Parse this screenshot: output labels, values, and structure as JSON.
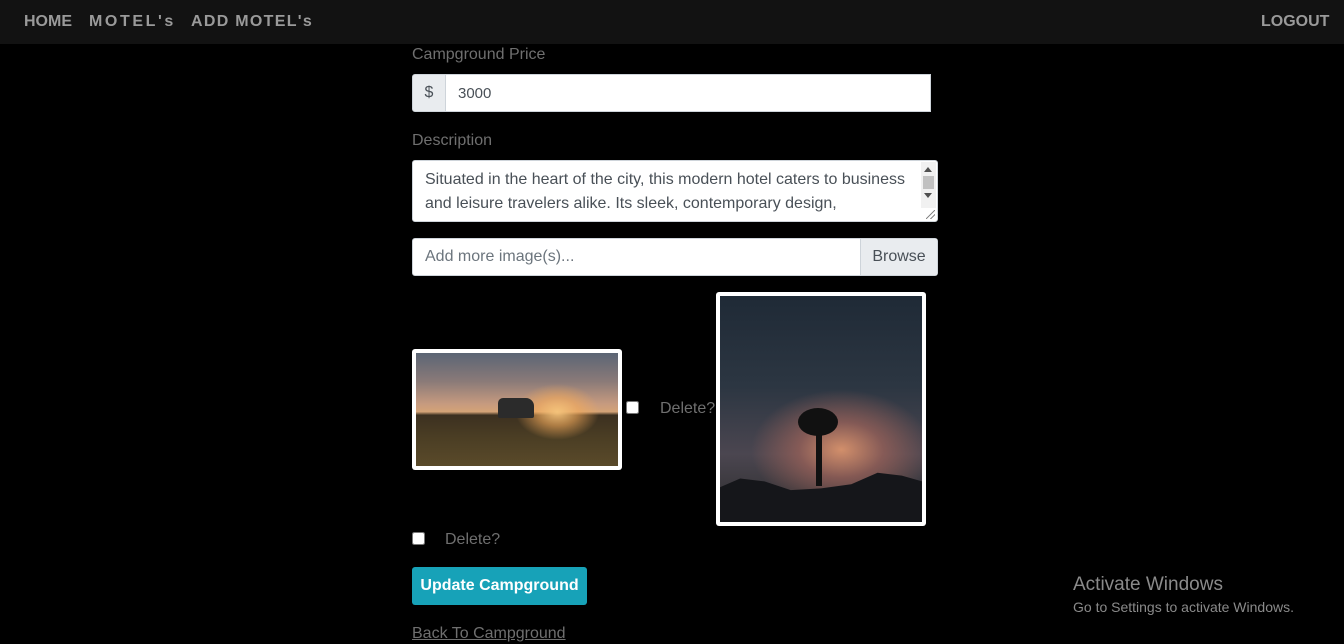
{
  "navbar": {
    "home": "HOME",
    "motels": "MOTEL's",
    "add_motels": "ADD MOTEL's",
    "logout": "LOGOUT"
  },
  "form": {
    "price_label": "Campground Price",
    "price_prefix": "$",
    "price_value": "3000",
    "description_label": "Description",
    "description_value": " Situated in the heart of the city, this modern hotel caters to business and leisure travelers alike. Its sleek, contemporary design,",
    "file_placeholder": "Add more image(s)...",
    "browse_label": "Browse",
    "delete_label_1": "Delete?",
    "delete_label_2": "Delete?",
    "update_button": "Update Campground",
    "back_link": "Back To Campground"
  },
  "watermark": {
    "title": "Activate Windows",
    "subtitle": "Go to Settings to activate Windows."
  },
  "colors": {
    "accent": "#17a2b8",
    "background": "#000000",
    "navbar": "#121212"
  }
}
